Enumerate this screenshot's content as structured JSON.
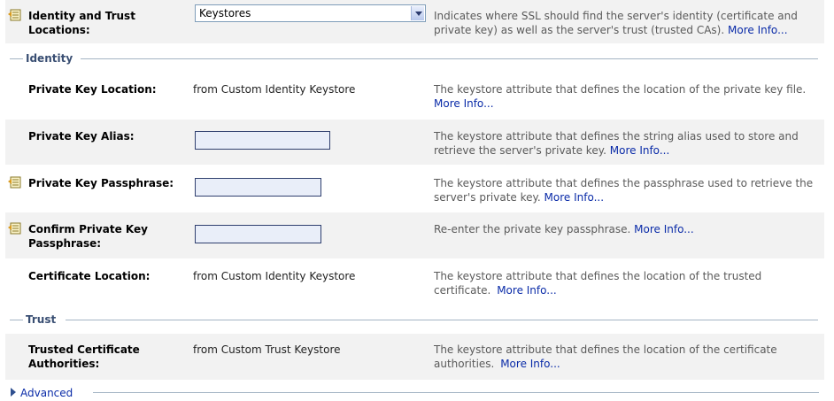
{
  "identity_and_trust": {
    "label": "Identity and Trust Locations:",
    "select_value": "Keystores",
    "description": "Indicates where SSL should find the server's identity (certificate and private key) as well as the server's trust (trusted CAs).",
    "more": "More Info..."
  },
  "sections": {
    "identity": "Identity",
    "trust": "Trust"
  },
  "private_key_location": {
    "label": "Private Key Location:",
    "value": "from Custom Identity Keystore",
    "description": "The keystore attribute that defines the location of the private key file.",
    "more": "More Info..."
  },
  "private_key_alias": {
    "label": "Private Key Alias:",
    "value": "",
    "description": "The keystore attribute that defines the string alias used to store and retrieve the server's private key.",
    "more": "More Info..."
  },
  "private_key_passphrase": {
    "label": "Private Key Passphrase:",
    "value": "",
    "description": "The keystore attribute that defines the passphrase used to retrieve the server's private key.",
    "more": "More Info..."
  },
  "confirm_passphrase": {
    "label": "Confirm Private Key Passphrase:",
    "value": "",
    "description": "Re-enter the private key passphrase.",
    "more": "More Info..."
  },
  "certificate_location": {
    "label": "Certificate Location:",
    "value": "from Custom Identity Keystore",
    "description": "The keystore attribute that defines the location of the trusted certificate.",
    "more": "More Info..."
  },
  "trusted_cas": {
    "label": "Trusted Certificate Authorities:",
    "value": "from Custom Trust Keystore",
    "description": "The keystore attribute that defines the location of the certificate authorities.",
    "more": "More Info..."
  },
  "advanced": {
    "label": "Advanced"
  }
}
